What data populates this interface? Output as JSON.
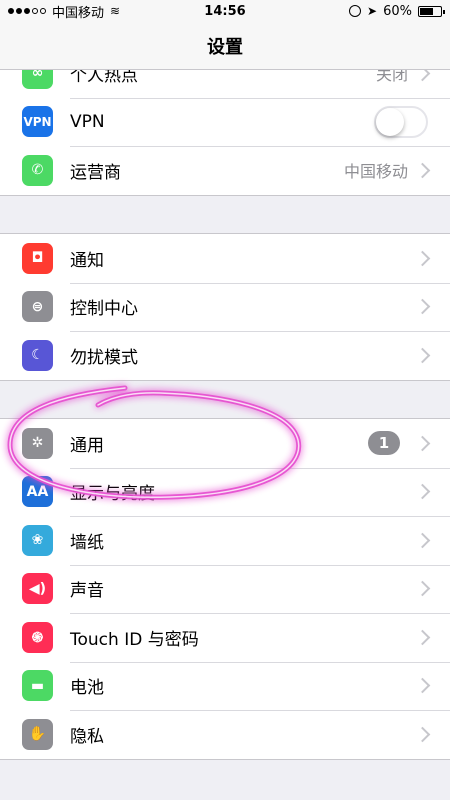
{
  "status": {
    "carrier": "中国移动",
    "time": "14:56",
    "battery": "60%",
    "battery_level": 0.6
  },
  "nav": {
    "title": "设置"
  },
  "groups": [
    {
      "rows": [
        {
          "label": "个人热点",
          "value": "关闭",
          "icon": "hotspot-icon",
          "color": "#4cd964"
        },
        {
          "label": "VPN",
          "icon": "vpn-icon",
          "color": "#1a73e8",
          "icon_text": "VPN",
          "toggle": false
        },
        {
          "label": "运营商",
          "value": "中国移动",
          "icon": "phone-icon",
          "color": "#4cd964"
        }
      ]
    },
    {
      "rows": [
        {
          "label": "通知",
          "icon": "notification-icon",
          "color": "#ff3b30"
        },
        {
          "label": "控制中心",
          "icon": "control-center-icon",
          "color": "#8e8e93"
        },
        {
          "label": "勿扰模式",
          "icon": "moon-icon",
          "color": "#5856d6"
        }
      ]
    },
    {
      "rows": [
        {
          "label": "通用",
          "icon": "gear-icon",
          "color": "#8e8e93",
          "badge": "1"
        },
        {
          "label": "显示与亮度",
          "icon": "display-brightness-icon",
          "color": "#1e6fd9",
          "icon_text": "AA"
        },
        {
          "label": "墙纸",
          "icon": "wallpaper-flower-icon",
          "color": "#34aadc"
        },
        {
          "label": "声音",
          "icon": "speaker-icon",
          "color": "#ff2d55"
        },
        {
          "label": "Touch ID 与密码",
          "icon": "fingerprint-icon",
          "color": "#ff2d55"
        },
        {
          "label": "电池",
          "icon": "battery-icon",
          "color": "#4cd964"
        },
        {
          "label": "隐私",
          "icon": "hand-icon",
          "color": "#8e8e93"
        }
      ]
    }
  ]
}
